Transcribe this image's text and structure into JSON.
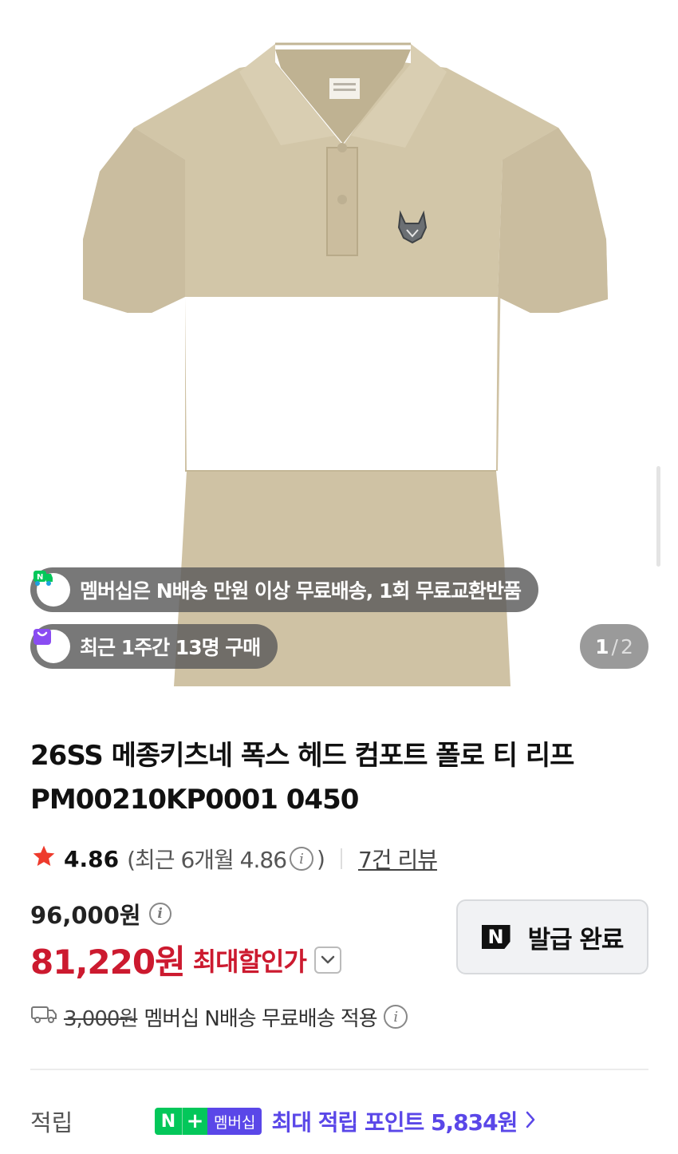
{
  "gallery": {
    "image_alt": "beige polo shirt with fox head patch",
    "scroll_hint": true,
    "counter_current": "1",
    "counter_separator": "/",
    "counter_total": "2"
  },
  "badges": {
    "membership_text": "멤버십은 N배송 만원 이상 무료배송, 1회 무료교환반품",
    "recent_purchase_text": "최근 1주간 13명 구매"
  },
  "product": {
    "title": "26SS 메종키츠네 폭스 헤드 컴포트 폴로 티 리프 PM00210KP0001 0450"
  },
  "rating": {
    "score": "4.86",
    "recent_prefix": "(최근 6개월 4.86",
    "recent_suffix": ")",
    "review_link": "7건 리뷰"
  },
  "price": {
    "original": "96,000원",
    "sale": "81,220원",
    "sale_label": "최대할인가"
  },
  "coupon": {
    "label": "발급 완료"
  },
  "shipping": {
    "original_fee": "3,000원",
    "text": "멤버십 N배송 무료배송 적용"
  },
  "points": {
    "title": "적립",
    "badge_n": "N",
    "badge_plus": "+",
    "badge_membership": "멤버십",
    "text": "최대 적립 포인트 5,834원"
  },
  "colors": {
    "sale_red": "#cc1a2f",
    "naver_green": "#03c75a",
    "membership_purple": "#5a47e8",
    "star_red": "#ee3a2c",
    "shirt_beige": "#cfc2a4"
  }
}
